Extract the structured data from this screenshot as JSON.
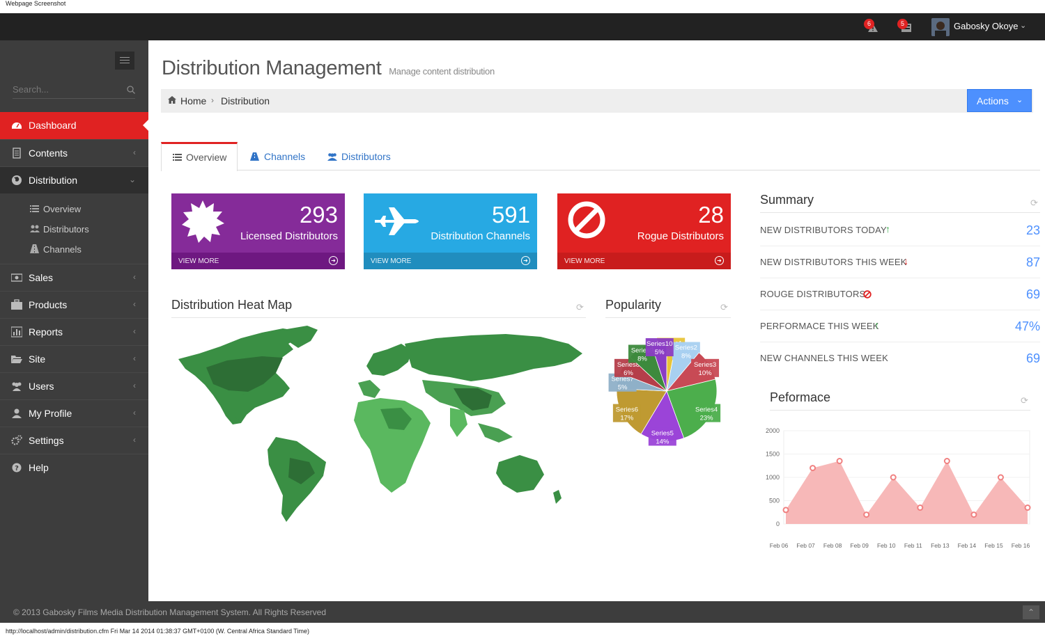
{
  "caption": "Webpage Screenshot",
  "topbar": {
    "notifications": [
      {
        "count": "6",
        "icon": "warning-icon"
      },
      {
        "count": "5",
        "icon": "inbox-icon"
      }
    ],
    "username": "Gabosky Okoye"
  },
  "sidebar": {
    "search_placeholder": "Search...",
    "items": [
      {
        "label": "Dashboard",
        "icon": "dashboard-icon",
        "active": true
      },
      {
        "label": "Contents",
        "icon": "file-icon"
      },
      {
        "label": "Distribution",
        "icon": "globe-icon",
        "open": true
      },
      {
        "label": "Sales",
        "icon": "money-icon"
      },
      {
        "label": "Products",
        "icon": "briefcase-icon"
      },
      {
        "label": "Reports",
        "icon": "bar-chart-icon"
      },
      {
        "label": "Site",
        "icon": "folder-open-icon"
      },
      {
        "label": "Users",
        "icon": "group-icon"
      },
      {
        "label": "My Profile",
        "icon": "user-icon"
      },
      {
        "label": "Settings",
        "icon": "cogs-icon"
      },
      {
        "label": "Help",
        "icon": "question-icon"
      }
    ],
    "subitems": [
      {
        "label": "Overview",
        "icon": "list-icon"
      },
      {
        "label": "Distributors",
        "icon": "group-icon"
      },
      {
        "label": "Channels",
        "icon": "road-icon"
      }
    ]
  },
  "page": {
    "title": "Distribution Management",
    "subtitle": "Manage content distribution"
  },
  "breadcrumb": {
    "home": "Home",
    "current": "Distribution"
  },
  "actions_label": "Actions",
  "tabs": [
    {
      "label": "Overview",
      "icon": "list-icon",
      "active": true
    },
    {
      "label": "Channels",
      "icon": "road-icon"
    },
    {
      "label": "Distributors",
      "icon": "group-icon"
    }
  ],
  "stats": [
    {
      "number": "293",
      "label": "Licensed Distributors",
      "more": "VIEW MORE",
      "color": "#852b99",
      "footer_color": "#6e1881",
      "icon": "certificate-icon"
    },
    {
      "number": "591",
      "label": "Distribution Channels",
      "more": "VIEW MORE",
      "color": "#27a9e3",
      "footer_color": "#208dbe",
      "icon": "plane-icon"
    },
    {
      "number": "28",
      "label": "Rogue Distributors",
      "more": "VIEW MORE",
      "color": "#e02222",
      "footer_color": "#c81c1c",
      "icon": "ban-icon"
    }
  ],
  "heatmap": {
    "title": "Distribution Heat Map"
  },
  "popularity": {
    "title": "Popularity"
  },
  "summary": {
    "title": "Summary",
    "rows": [
      {
        "label": "NEW DISTRIBUTORS TODAY",
        "value": "23",
        "mark": "arrow-up-icon"
      },
      {
        "label": "NEW DISTRIBUTORS THIS WEEK",
        "value": "87",
        "mark": "arrow-down-icon"
      },
      {
        "label": "ROUGE DISTRIBUTORS",
        "value": "69",
        "mark": "ban-icon"
      },
      {
        "label": "PERFORMACE THIS WEEK",
        "value": "47%",
        "mark": "arrow-up-icon"
      },
      {
        "label": "NEW CHANNELS THIS WEEK",
        "value": "69",
        "mark": ""
      }
    ]
  },
  "performance": {
    "title": "Peformace"
  },
  "chart_data": [
    {
      "type": "pie",
      "slices": [
        {
          "name": "Series1",
          "value": 3,
          "label": "3%",
          "color": "#e8c438"
        },
        {
          "name": "Series2",
          "value": 8,
          "label": "8%",
          "color": "#a8d0f0"
        },
        {
          "name": "Series3",
          "value": 10,
          "label": "10%",
          "color": "#c84a55"
        },
        {
          "name": "Series4",
          "value": 23,
          "label": "23%",
          "color": "#4cae4c"
        },
        {
          "name": "Series5",
          "value": 14,
          "label": "14%",
          "color": "#9b44d8"
        },
        {
          "name": "Series6",
          "value": 17,
          "label": "17%",
          "color": "#bf9a32"
        },
        {
          "name": "Series7",
          "value": 5,
          "label": "5%",
          "color": "#8fb0c8"
        },
        {
          "name": "Series8",
          "value": 6,
          "label": "6%",
          "color": "#b53e4a"
        },
        {
          "name": "Series9",
          "value": 8,
          "label": "8%",
          "color": "#3d8a3d"
        },
        {
          "name": "Series10",
          "value": 5,
          "label": "5%",
          "color": "#8a3cc4"
        }
      ]
    },
    {
      "type": "area",
      "categories": [
        "Feb 06",
        "Feb 07",
        "Feb 08",
        "Feb 09",
        "Feb 10",
        "Feb 11",
        "Feb 13",
        "Feb 14",
        "Feb 15",
        "Feb 16"
      ],
      "values": [
        300,
        1200,
        1350,
        200,
        1000,
        350,
        1350,
        200,
        1000,
        350
      ],
      "ylim": [
        0,
        2000
      ],
      "yticks": [
        "2000",
        "1500",
        "1000",
        "500",
        "0"
      ],
      "color": "#f7b8b8",
      "point_color": "#f08080"
    }
  ],
  "footer": {
    "copyright": "© 2013 Gabosky Films Media Distribution Management System. All Rights Reserved"
  },
  "statusline": "http://localhost/admin/distribution.cfm Fri Mar 14 2014 01:38:37 GMT+0100 (W. Central Africa Standard Time)"
}
